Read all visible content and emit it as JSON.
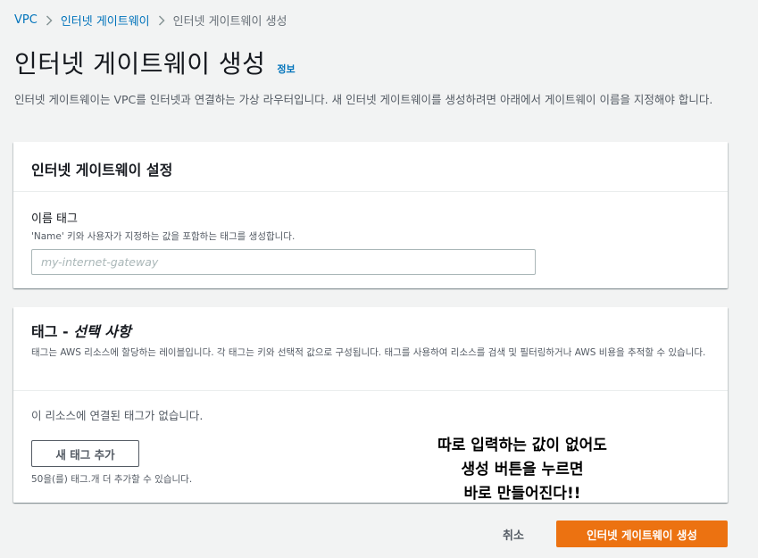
{
  "breadcrumb": {
    "items": [
      {
        "label": "VPC"
      },
      {
        "label": "인터넷 게이트웨이"
      },
      {
        "label": "인터넷 게이트웨이 생성"
      }
    ]
  },
  "header": {
    "title": "인터넷 게이트웨이 생성",
    "info_label": "정보",
    "description": "인터넷 게이트웨이는 VPC를 인터넷과 연결하는 가상 라우터입니다. 새 인터넷 게이트웨이를 생성하려면 아래에서 게이트웨이 이름을 지정해야 합니다."
  },
  "settings_card": {
    "title": "인터넷 게이트웨이 설정",
    "name_tag": {
      "label": "이름 태그",
      "description": "'Name' 키와 사용자가 지정하는 값을 포함하는 태그를 생성합니다.",
      "value": "",
      "placeholder": "my-internet-gateway"
    }
  },
  "tags_card": {
    "title_main": "태그 - ",
    "title_optional": "선택 사항",
    "description": "태그는 AWS 리소스에 할당하는 레이블입니다. 각 태그는 키와 선택적 값으로 구성됩니다. 태그를 사용하여 리소스를 검색 및 필터링하거나 AWS 비용을 추적할 수 있습니다.",
    "empty_message": "이 리소스에 연결된 태그가 없습니다.",
    "add_button_label": "새 태그 추가",
    "limit_text": "50을(를) 태그.개 더 추가할 수 있습니다."
  },
  "annotation": {
    "lines": [
      "따로 입력하는 값이 없어도",
      "생성 버튼을 누르면",
      "바로 만들어진다!!"
    ]
  },
  "footer": {
    "cancel_label": "취소",
    "submit_label": "인터넷 게이트웨이 생성"
  },
  "colors": {
    "link": "#0073bb",
    "primary_button": "#ec7211",
    "background": "#f2f3f3",
    "card": "#ffffff",
    "text_secondary": "#545b64"
  },
  "icons": {
    "breadcrumb_separator": "chevron-right-icon"
  }
}
